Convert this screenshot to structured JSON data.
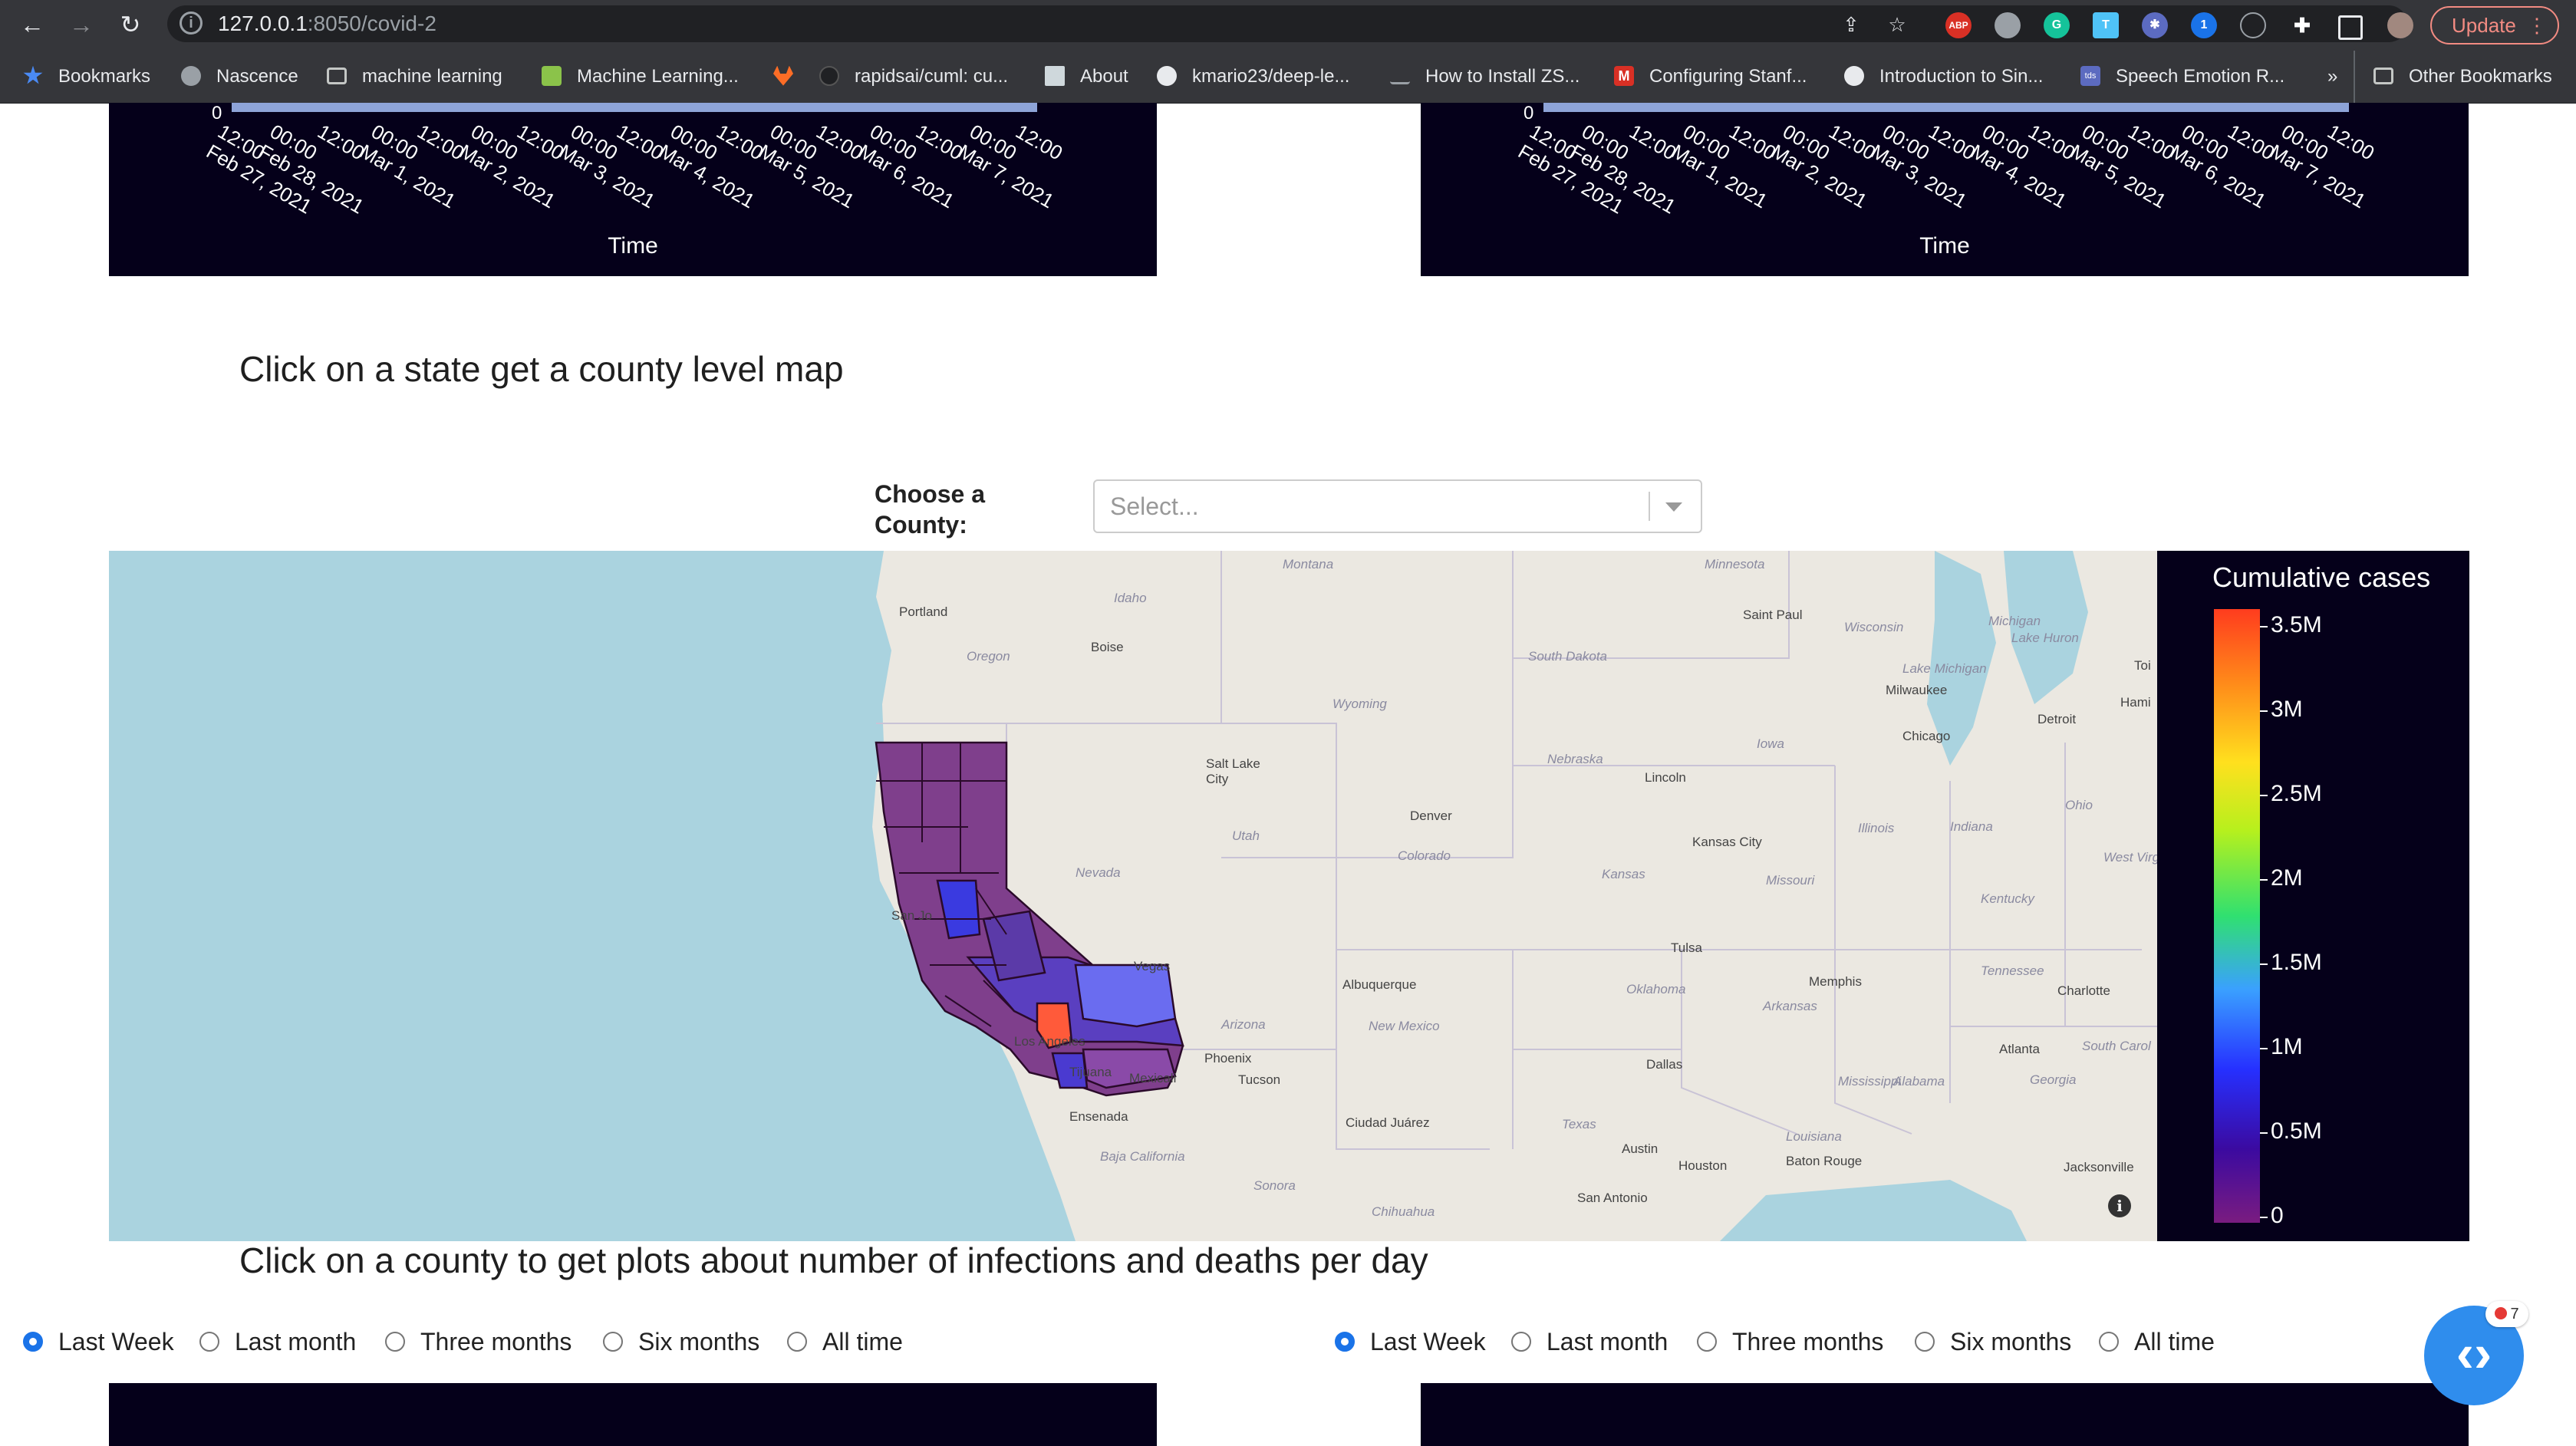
{
  "browser": {
    "url_host": "127.0.0.1",
    "url_path": ":8050/covid-2",
    "update_label": "Update",
    "bookmarks": [
      {
        "label": "Bookmarks",
        "icon": "star-icon",
        "color": "#4a8af4"
      },
      {
        "label": "Nascence",
        "icon": "globe-icon",
        "color": "#9aa0a6"
      },
      {
        "label": "machine learning",
        "icon": "folder-icon",
        "color": "#9aa0a6"
      },
      {
        "label": "Machine Learning...",
        "icon": "smiley-icon",
        "color": "#8bc34a"
      },
      {
        "label": "",
        "icon": "gitlab-icon",
        "color": "#fc6d26"
      },
      {
        "label": "rapidsai/cuml: cu...",
        "icon": "github-icon",
        "color": "#202124"
      },
      {
        "label": "About",
        "icon": "page-icon",
        "color": "#cfd8dc"
      },
      {
        "label": "kmario23/deep-le...",
        "icon": "github-icon",
        "color": "#e8eaed"
      },
      {
        "label": "How to Install ZS...",
        "icon": "link-icon",
        "color": "#35363a"
      },
      {
        "label": "Configuring Stanf...",
        "icon": "gmail-icon",
        "color": "#d93025"
      },
      {
        "label": "Introduction to Sin...",
        "icon": "globe-icon",
        "color": "#e8eaed"
      },
      {
        "label": "Speech Emotion R...",
        "icon": "tds-icon",
        "color": "#5c6bc0"
      },
      {
        "label": "»",
        "icon": "",
        "color": ""
      },
      {
        "label": "Other Bookmarks",
        "icon": "folder-icon",
        "color": "#9aa0a6"
      }
    ]
  },
  "top_plots": {
    "axis_zero": "0",
    "time_label": "Time",
    "ticks": [
      "12:00\nFeb 27, 2021",
      "00:00\nFeb 28, 2021",
      "12:00",
      "00:00\nMar 1, 2021",
      "12:00",
      "00:00\nMar 2, 2021",
      "12:00",
      "00:00\nMar 3, 2021",
      "12:00",
      "00:00\nMar 4, 2021",
      "12:00",
      "00:00\nMar 5, 2021",
      "12:00",
      "00:00\nMar 6, 2021",
      "12:00",
      "00:00\nMar 7, 2021",
      "12:00"
    ]
  },
  "state_section": {
    "heading": "Click on a state get a county level map",
    "county_label": "Choose a\nCounty:",
    "select_placeholder": "Select..."
  },
  "map": {
    "labels": [
      {
        "text": "Montana",
        "kind": "state"
      },
      {
        "text": "Minnesota",
        "kind": "state"
      },
      {
        "text": "Portland",
        "kind": "city"
      },
      {
        "text": "Idaho",
        "kind": "state"
      },
      {
        "text": "Saint Paul",
        "kind": "city"
      },
      {
        "text": "Wisconsin",
        "kind": "state"
      },
      {
        "text": "Michigan",
        "kind": "state"
      },
      {
        "text": "Oregon",
        "kind": "state"
      },
      {
        "text": "Boise",
        "kind": "city"
      },
      {
        "text": "South Dakota",
        "kind": "state"
      },
      {
        "text": "Lake Huron",
        "kind": "state"
      },
      {
        "text": "Lake Michigan",
        "kind": "state"
      },
      {
        "text": "Milwaukee",
        "kind": "city"
      },
      {
        "text": "Wyoming",
        "kind": "state"
      },
      {
        "text": "Detroit",
        "kind": "city"
      },
      {
        "text": "Chicago",
        "kind": "city"
      },
      {
        "text": "Iowa",
        "kind": "state"
      },
      {
        "text": "Nebraska",
        "kind": "state"
      },
      {
        "text": "Salt Lake\nCity",
        "kind": "city"
      },
      {
        "text": "Lincoln",
        "kind": "city"
      },
      {
        "text": "Ohio",
        "kind": "state"
      },
      {
        "text": "Denver",
        "kind": "city"
      },
      {
        "text": "Illinois",
        "kind": "state"
      },
      {
        "text": "Indiana",
        "kind": "state"
      },
      {
        "text": "Utah",
        "kind": "state"
      },
      {
        "text": "Colorado",
        "kind": "state"
      },
      {
        "text": "Kansas City",
        "kind": "city"
      },
      {
        "text": "Nevada",
        "kind": "state"
      },
      {
        "text": "Kansas",
        "kind": "state"
      },
      {
        "text": "Missouri",
        "kind": "state"
      },
      {
        "text": "West Virg",
        "kind": "state"
      },
      {
        "text": "Kentucky",
        "kind": "state"
      },
      {
        "text": "San Jo",
        "kind": "city"
      },
      {
        "text": "Tulsa",
        "kind": "city"
      },
      {
        "text": "Vegas",
        "kind": "city"
      },
      {
        "text": "Albuquerque",
        "kind": "city"
      },
      {
        "text": "Oklahoma",
        "kind": "state"
      },
      {
        "text": "Memphis",
        "kind": "city"
      },
      {
        "text": "Tennessee",
        "kind": "state"
      },
      {
        "text": "Charlotte",
        "kind": "city"
      },
      {
        "text": "Arkansas",
        "kind": "state"
      },
      {
        "text": "Arizona",
        "kind": "state"
      },
      {
        "text": "New Mexico",
        "kind": "state"
      },
      {
        "text": "Los Angeles",
        "kind": "city"
      },
      {
        "text": "Atlanta",
        "kind": "city"
      },
      {
        "text": "South Carol",
        "kind": "state"
      },
      {
        "text": "Phoenix",
        "kind": "city"
      },
      {
        "text": "Dallas",
        "kind": "city"
      },
      {
        "text": "Tijuana",
        "kind": "city"
      },
      {
        "text": "Mexicali",
        "kind": "city"
      },
      {
        "text": "Tucson",
        "kind": "city"
      },
      {
        "text": "Mississippi",
        "kind": "state"
      },
      {
        "text": "Alabama",
        "kind": "state"
      },
      {
        "text": "Georgia",
        "kind": "state"
      },
      {
        "text": "Ensenada",
        "kind": "city"
      },
      {
        "text": "Ciudad Juárez",
        "kind": "city"
      },
      {
        "text": "Texas",
        "kind": "state"
      },
      {
        "text": "Louisiana",
        "kind": "state"
      },
      {
        "text": "Austin",
        "kind": "city"
      },
      {
        "text": "Baja California",
        "kind": "state"
      },
      {
        "text": "Houston",
        "kind": "city"
      },
      {
        "text": "Baton Rouge",
        "kind": "city"
      },
      {
        "text": "Jacksonville",
        "kind": "city"
      },
      {
        "text": "Sonora",
        "kind": "state"
      },
      {
        "text": "San Antonio",
        "kind": "city"
      },
      {
        "text": "Chihuahua",
        "kind": "state"
      },
      {
        "text": "Toi",
        "kind": "city"
      },
      {
        "text": "Hami",
        "kind": "city"
      }
    ],
    "colorbar": {
      "title": "Cumulative cases",
      "ticks": [
        "3.5M",
        "3M",
        "2.5M",
        "2M",
        "1.5M",
        "1M",
        "0.5M",
        "0"
      ]
    },
    "info_glyph": "i"
  },
  "county_section": {
    "heading": "Click on a county to get plots about number of infections and deaths per day",
    "left_options": [
      "Last Week",
      "Last month",
      "Three months",
      "Six months",
      "All time"
    ],
    "right_options": [
      "Last Week",
      "Last month",
      "Three months",
      "Six months",
      "All time"
    ],
    "selected": "Last Week"
  },
  "fab": {
    "badge_count": "7"
  }
}
